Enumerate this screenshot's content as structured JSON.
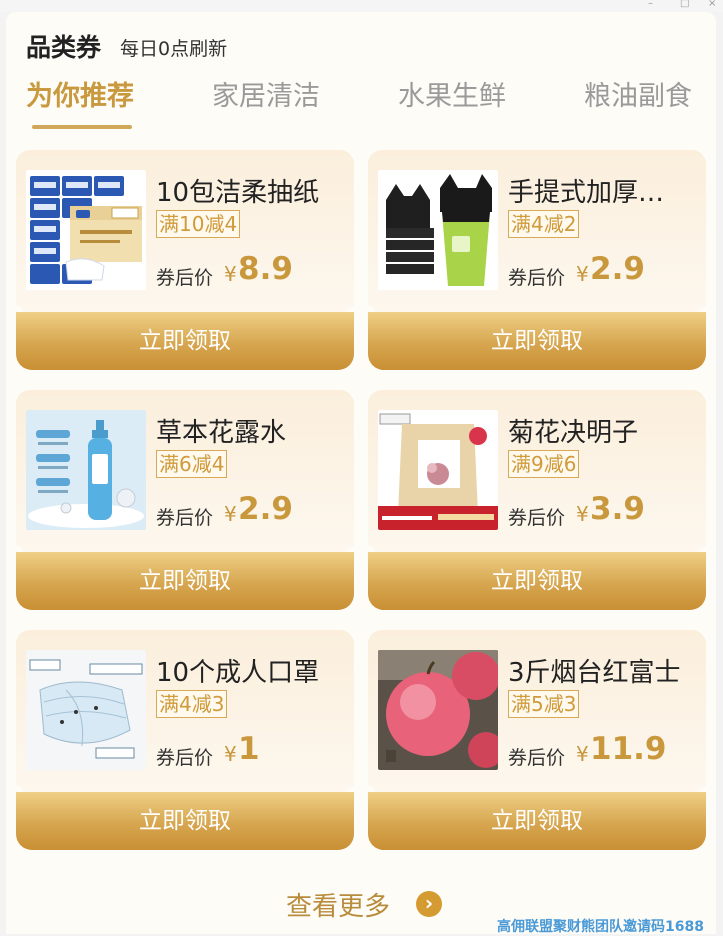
{
  "header": {
    "title": "品类券",
    "subtitle": "每日0点刷新"
  },
  "tabs": [
    {
      "label": "为你推荐",
      "active": true
    },
    {
      "label": "家居清洁",
      "active": false
    },
    {
      "label": "水果生鲜",
      "active": false
    },
    {
      "label": "粮油副食",
      "active": false
    }
  ],
  "products": [
    {
      "name": "10包洁柔抽纸",
      "coupon": "满10减4",
      "price_label": "券后价",
      "currency": "¥",
      "price": "8.9",
      "image": "tissue-pack"
    },
    {
      "name": "手提式加厚…",
      "coupon": "满4减2",
      "price_label": "券后价",
      "currency": "¥",
      "price": "2.9",
      "image": "trash-bags"
    },
    {
      "name": "草本花露水",
      "coupon": "满6减4",
      "price_label": "券后价",
      "currency": "¥",
      "price": "2.9",
      "image": "toilet-water-bottle"
    },
    {
      "name": "菊花决明子",
      "coupon": "满9减6",
      "price_label": "券后价",
      "currency": "¥",
      "price": "3.9",
      "image": "herbal-tea-bag"
    },
    {
      "name": "10个成人口罩",
      "coupon": "满4减3",
      "price_label": "券后价",
      "currency": "¥",
      "price": "1",
      "image": "face-mask"
    },
    {
      "name": "3斤烟台红富士",
      "coupon": "满5减3",
      "price_label": "券后价",
      "currency": "¥",
      "price": "11.9",
      "image": "red-apples"
    }
  ],
  "claim_label": "立即领取",
  "more_label": "查看更多",
  "watermark": "高佣联盟聚财熊团队邀请码1688",
  "colors": {
    "accent": "#c8993e",
    "button": "#d6a64f",
    "background": "#fefcf6"
  }
}
